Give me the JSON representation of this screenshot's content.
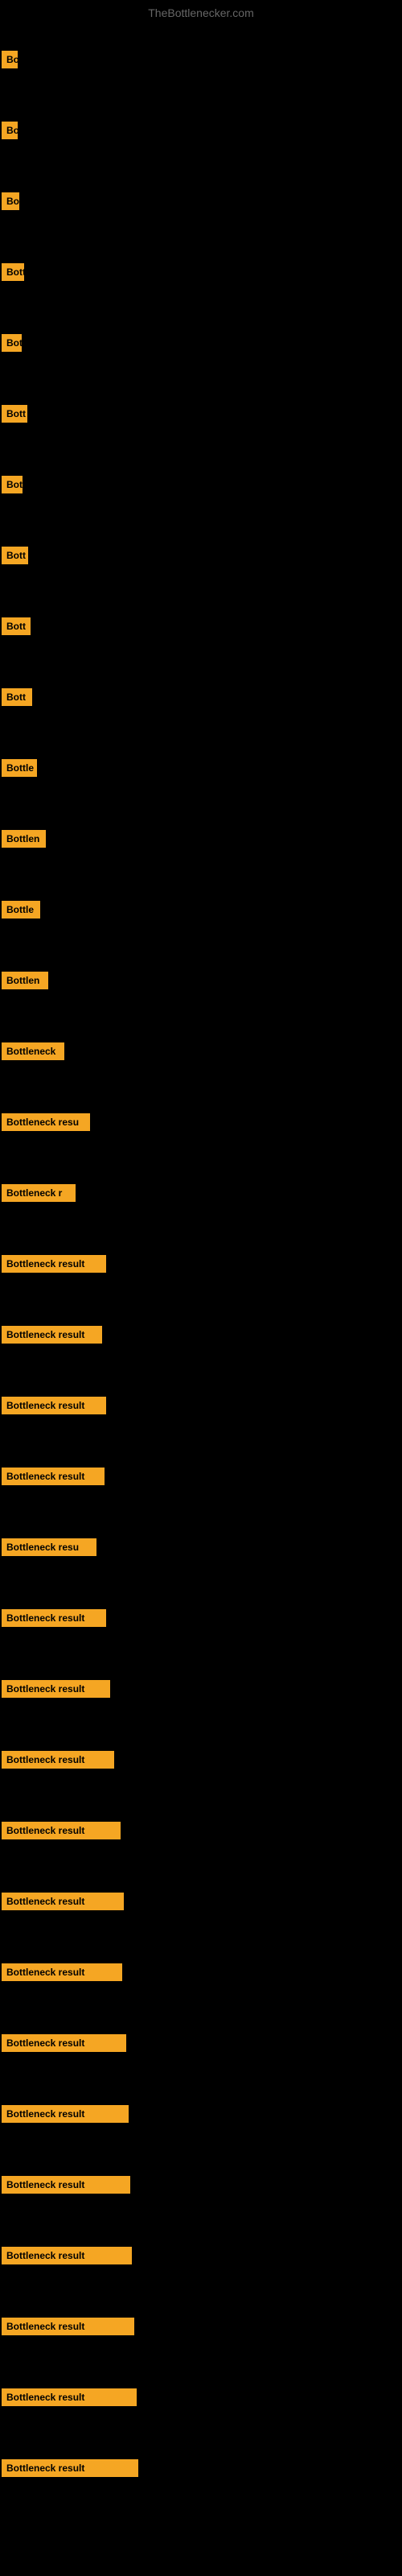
{
  "site": {
    "title": "TheBottlenecker.com"
  },
  "bars": [
    {
      "label": "Bo",
      "width": 20
    },
    {
      "label": "Bo",
      "width": 20
    },
    {
      "label": "Bo",
      "width": 22
    },
    {
      "label": "Bott",
      "width": 28
    },
    {
      "label": "Bot",
      "width": 25
    },
    {
      "label": "Bott",
      "width": 32
    },
    {
      "label": "Bot",
      "width": 26
    },
    {
      "label": "Bott",
      "width": 33
    },
    {
      "label": "Bott",
      "width": 36
    },
    {
      "label": "Bott",
      "width": 38
    },
    {
      "label": "Bottle",
      "width": 44
    },
    {
      "label": "Bottlen",
      "width": 55
    },
    {
      "label": "Bottle",
      "width": 48
    },
    {
      "label": "Bottlen",
      "width": 58
    },
    {
      "label": "Bottleneck",
      "width": 78
    },
    {
      "label": "Bottleneck resu",
      "width": 110
    },
    {
      "label": "Bottleneck r",
      "width": 92
    },
    {
      "label": "Bottleneck result",
      "width": 130
    },
    {
      "label": "Bottleneck result",
      "width": 125
    },
    {
      "label": "Bottleneck result",
      "width": 130
    },
    {
      "label": "Bottleneck result",
      "width": 128
    },
    {
      "label": "Bottleneck resu",
      "width": 118
    },
    {
      "label": "Bottleneck result",
      "width": 130
    },
    {
      "label": "Bottleneck result",
      "width": 135
    },
    {
      "label": "Bottleneck result",
      "width": 140
    },
    {
      "label": "Bottleneck result",
      "width": 148
    },
    {
      "label": "Bottleneck result",
      "width": 152
    },
    {
      "label": "Bottleneck result",
      "width": 150
    },
    {
      "label": "Bottleneck result",
      "width": 155
    },
    {
      "label": "Bottleneck result",
      "width": 158
    },
    {
      "label": "Bottleneck result",
      "width": 160
    },
    {
      "label": "Bottleneck result",
      "width": 162
    },
    {
      "label": "Bottleneck result",
      "width": 165
    },
    {
      "label": "Bottleneck result",
      "width": 168
    },
    {
      "label": "Bottleneck result",
      "width": 170
    }
  ]
}
